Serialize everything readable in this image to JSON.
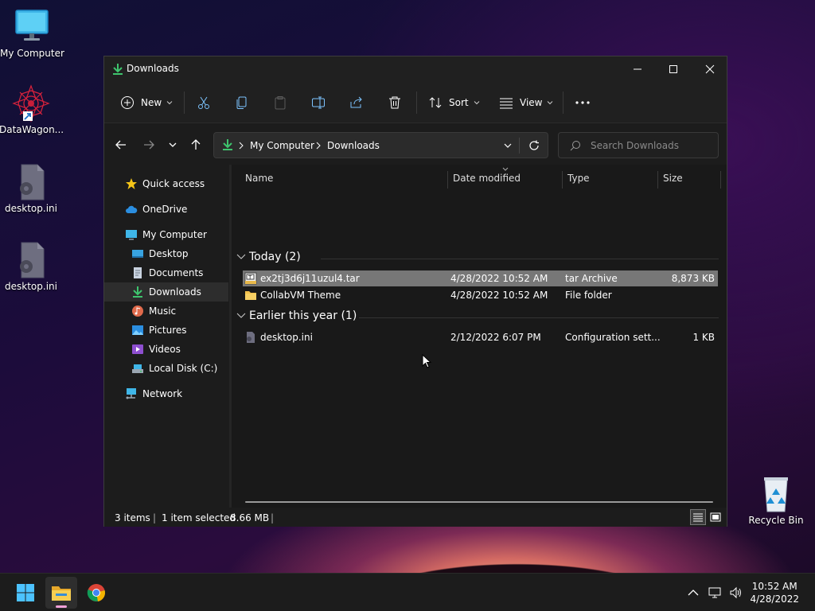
{
  "desktop": {
    "icons": [
      {
        "label": "My Computer"
      },
      {
        "label": "DataWagon..."
      },
      {
        "label": "desktop.ini"
      },
      {
        "label": "desktop.ini"
      },
      {
        "label": "Recycle Bin"
      }
    ]
  },
  "window": {
    "title": "Downloads",
    "toolbar": {
      "new_label": "New",
      "sort_label": "Sort",
      "view_label": "View"
    },
    "address": {
      "crumbs": [
        "My Computer",
        "Downloads"
      ]
    },
    "search": {
      "placeholder": "Search Downloads"
    },
    "navpane": {
      "quick_access": "Quick access",
      "onedrive": "OneDrive",
      "my_computer": "My Computer",
      "desktop": "Desktop",
      "documents": "Documents",
      "downloads": "Downloads",
      "music": "Music",
      "pictures": "Pictures",
      "videos": "Videos",
      "local_disk": "Local Disk (C:)",
      "network": "Network"
    },
    "columns": {
      "name": "Name",
      "date": "Date modified",
      "type": "Type",
      "size": "Size"
    },
    "groups": [
      {
        "label": "Today (2)",
        "rows": [
          {
            "name": "ex2tj3d6j11uzul4.tar",
            "date": "4/28/2022 10:52 AM",
            "type": "tar Archive",
            "size": "8,873 KB"
          },
          {
            "name": "CollabVM Theme",
            "date": "4/28/2022 10:52 AM",
            "type": "File folder",
            "size": ""
          }
        ]
      },
      {
        "label": "Earlier this year (1)",
        "rows": [
          {
            "name": "desktop.ini",
            "date": "2/12/2022 6:07 PM",
            "type": "Configuration sett...",
            "size": "1 KB"
          }
        ]
      }
    ],
    "status": {
      "items": "3 items",
      "selected": "1 item selected",
      "size": "8.66 MB"
    }
  },
  "taskbar": {
    "time": "10:52 AM",
    "date": "4/28/2022"
  }
}
